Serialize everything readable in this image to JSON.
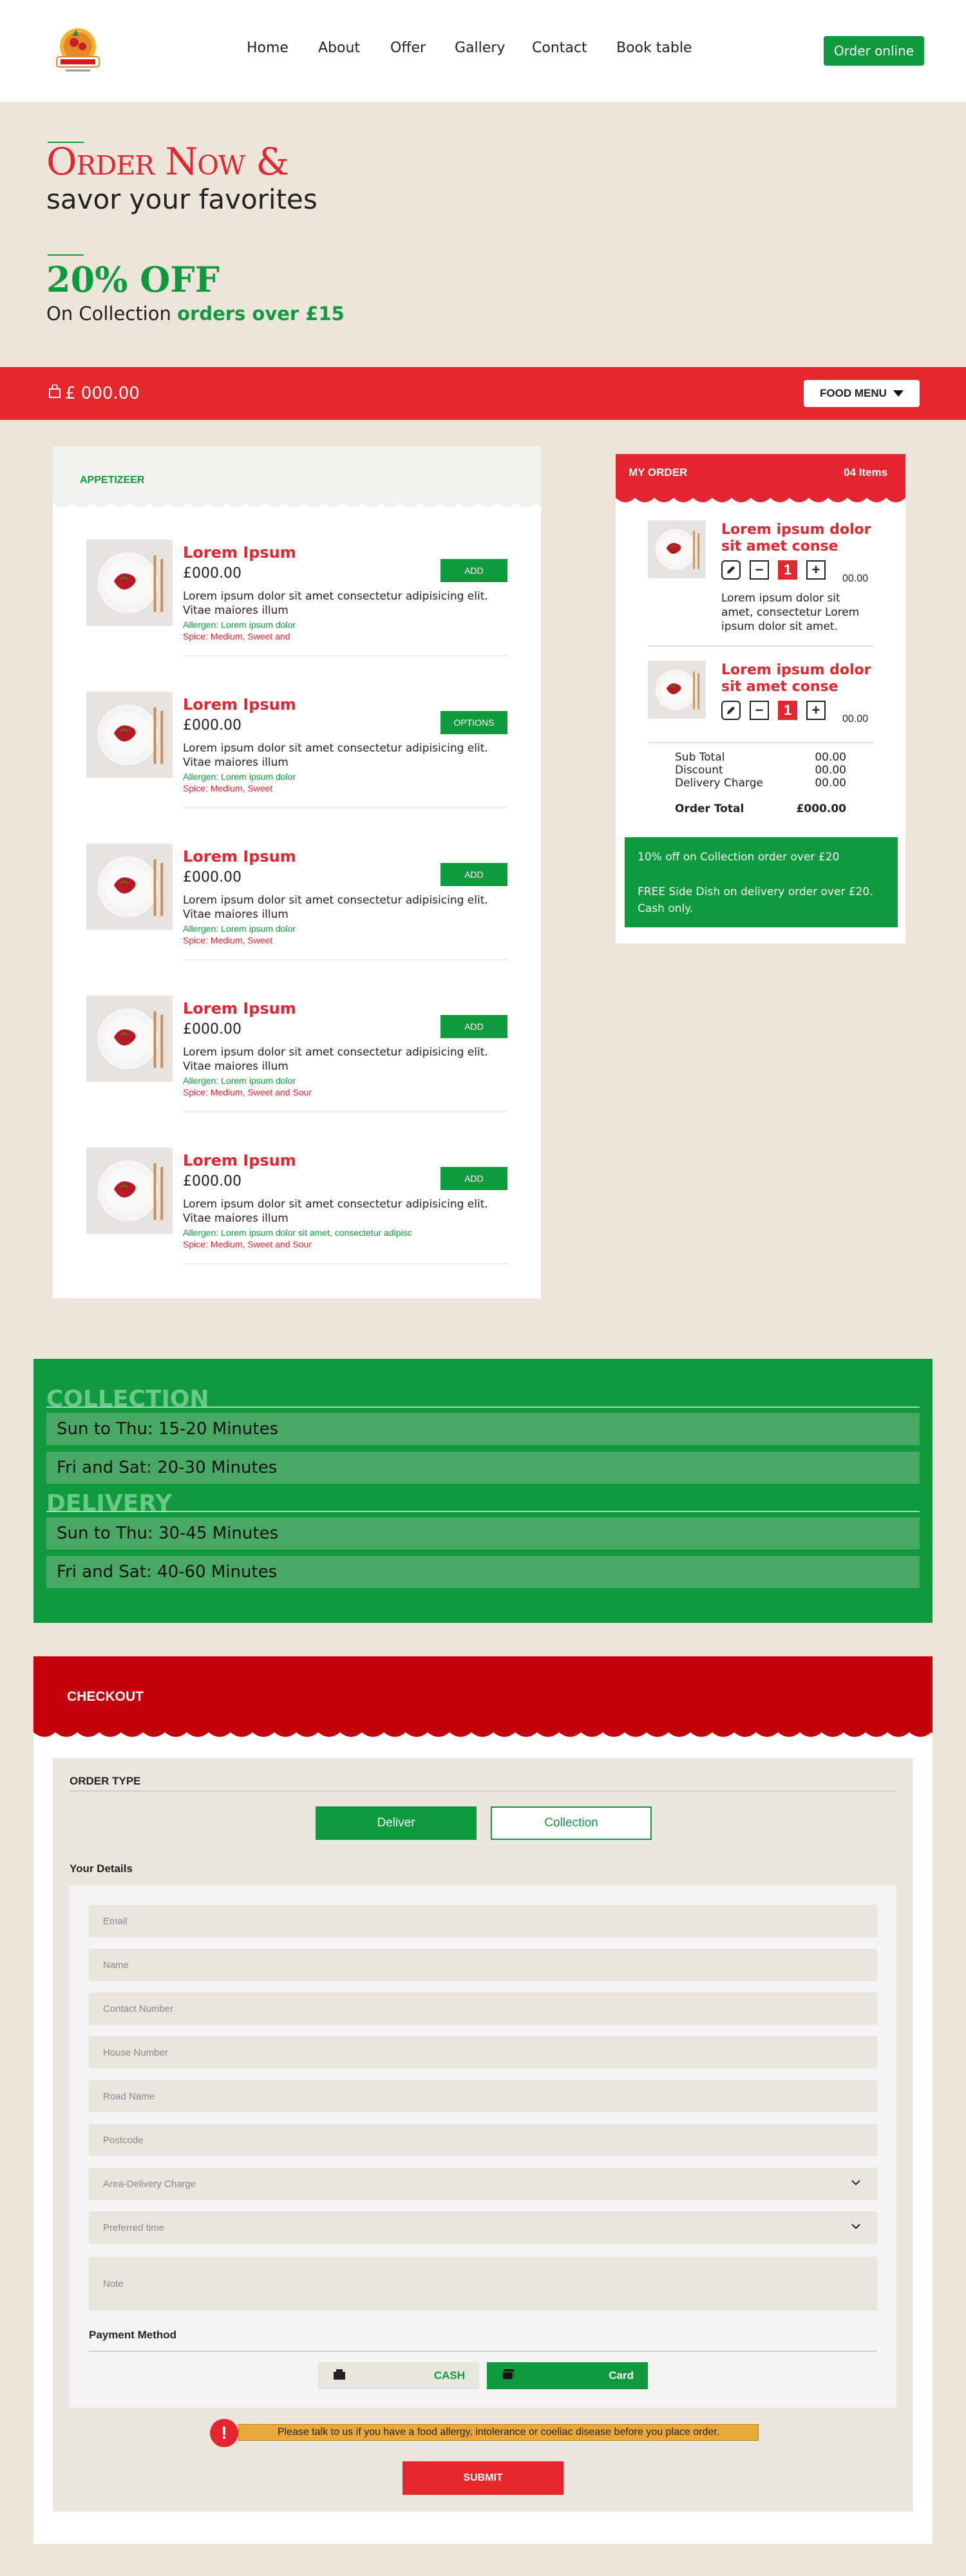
{
  "header": {
    "logo_icon": "restaurant-logo",
    "nav": [
      "Home",
      "About",
      "Offer",
      "Gallery",
      "Contact",
      "Book table"
    ],
    "cta": "Order online"
  },
  "hero": {
    "title": "Order Now &",
    "subtitle": "savor your favorites",
    "discount": "20% OFF",
    "discount_text": "On Collection",
    "discount_highlight": "orders over £15"
  },
  "bar": {
    "bag_icon": "shopping-bag-icon",
    "total": "£ 000.00",
    "menu_button": "FOOD MENU",
    "menu_icon": "caret-down-icon"
  },
  "menu": {
    "category": "APPETIZEER",
    "items": [
      {
        "name": "Lorem Ipsum",
        "price": "£000.00",
        "desc": "Lorem ipsum dolor sit amet consectetur adipisicing elit. Vitae maiores illum",
        "allergen": "Allergen: Lorem ipsum dolor",
        "spice": "Spice: Medium, Sweet and",
        "button": "ADD"
      },
      {
        "name": "Lorem Ipsum",
        "price": "£000.00",
        "desc": "Lorem ipsum dolor sit amet consectetur adipisicing elit. Vitae maiores illum",
        "allergen": "Allergen: Lorem ipsum dolor",
        "spice": "Spice: Medium, Sweet",
        "button": "OPTIONS"
      },
      {
        "name": "Lorem Ipsum",
        "price": "£000.00",
        "desc": "Lorem ipsum dolor sit amet consectetur adipisicing elit. Vitae maiores illum",
        "allergen": "Allergen: Lorem ipsum dolor",
        "spice": "Spice: Medium, Sweet",
        "button": "ADD"
      },
      {
        "name": "Lorem Ipsum",
        "price": "£000.00",
        "desc": "Lorem ipsum dolor sit amet consectetur adipisicing elit. Vitae maiores illum",
        "allergen": "Allergen: Lorem ipsum dolor",
        "spice": "Spice: Medium, Sweet and Sour",
        "button": "ADD"
      },
      {
        "name": "Lorem Ipsum",
        "price": "£000.00",
        "desc": "Lorem ipsum dolor sit amet consectetur adipisicing elit. Vitae maiores illum",
        "allergen": "Allergen: Lorem ipsum dolor sit amet, consectetur adipisc",
        "spice": "Spice: Medium, Sweet and Sour",
        "button": "ADD"
      }
    ]
  },
  "order": {
    "title": "MY ORDER",
    "count": "04 Items",
    "items": [
      {
        "name": "Lorem ipsum dolor sit amet conse",
        "qty": "1",
        "price": "00.00",
        "note": "Lorem ipsum dolor sit amet, consectetur Lorem ipsum dolor sit amet."
      },
      {
        "name": "Lorem ipsum dolor sit amet conse",
        "qty": "1",
        "price": "00.00",
        "note": ""
      }
    ],
    "minus": "−",
    "plus": "+",
    "edit_icon": "edit-pencil-icon",
    "summary": [
      {
        "label": "Sub Total",
        "value": "00.00"
      },
      {
        "label": "Discount",
        "value": "00.00"
      },
      {
        "label": "Delivery Charge",
        "value": "00.00"
      }
    ],
    "total_label": "Order Total",
    "total_value": "£000.00",
    "promo_1": "10% off on Collection order over £20",
    "promo_2": "FREE Side Dish on delivery order over £20. Cash only."
  },
  "times": {
    "collection_title": "COLLECTION",
    "collection": [
      "Sun to Thu: 15-20 Minutes",
      "Fri and Sat: 20-30 Minutes"
    ],
    "delivery_title": "DELIVERY",
    "delivery": [
      "Sun to Thu: 30-45 Minutes",
      "Fri and Sat: 40-60 Minutes"
    ]
  },
  "checkout": {
    "title": "CHECKOUT",
    "order_type": "ORDER TYPE",
    "deliver": "Deliver",
    "collection": "Collection",
    "your_details": "Your Details",
    "fields": [
      "Email",
      "Name",
      "Contact Number",
      "House Number",
      "Road Name",
      "Postcode",
      "Area-Delivery Charge",
      "Preferred time",
      "Note"
    ],
    "payment_method": "Payment Method",
    "cash": "CASH",
    "card": "Card",
    "cash_icon": "cash-icon",
    "card_icon": "card-icon",
    "allergy_icon": "!",
    "allergy_note": "Please talk to us if you have a food allergy, intolerance or coeliac disease before you place order.",
    "submit": "SUBMIT"
  },
  "colors": {
    "green": "#0f9a3e",
    "red": "#e3262f",
    "dark_red": "#c4000a",
    "cream": "#ede5d9"
  }
}
